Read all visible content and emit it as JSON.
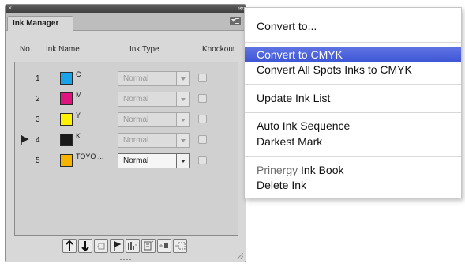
{
  "panel": {
    "tab_title": "Ink Manager",
    "close_glyph": "×",
    "collapse_glyph": "««",
    "headers": {
      "no": "No.",
      "ink_name": "Ink Name",
      "ink_type": "Ink Type",
      "knockout": "Knockout"
    }
  },
  "inks": [
    {
      "no": "1",
      "name": "C",
      "color": "#1aa3e8",
      "type": "Normal",
      "active": false,
      "marker": false
    },
    {
      "no": "2",
      "name": "M",
      "color": "#e0147f",
      "type": "Normal",
      "active": false,
      "marker": false
    },
    {
      "no": "3",
      "name": "Y",
      "color": "#fff200",
      "type": "Normal",
      "active": false,
      "marker": false
    },
    {
      "no": "4",
      "name": "K",
      "color": "#1a1a1a",
      "type": "Normal",
      "active": false,
      "marker": true
    },
    {
      "no": "5",
      "name": "TOYO ...",
      "color": "#f5b400",
      "type": "Normal",
      "active": true,
      "marker": false
    }
  ],
  "toolbar_icons": [
    "move-up-icon",
    "move-down-icon",
    "alias-ink-icon",
    "set-order-icon",
    "neutral-density-icon",
    "sort-icon",
    "add-ink-icon",
    "new-ink-icon"
  ],
  "menu": {
    "items": [
      {
        "label": "Convert to..."
      },
      {
        "label": "Convert to CMYK"
      },
      {
        "label": "Convert All Spots Inks to CMYK"
      },
      {
        "label": "Update Ink List"
      },
      {
        "label": "Auto Ink Sequence"
      },
      {
        "label": "Darkest Mark"
      },
      {
        "label_pre": "Prinergy",
        "label_post": " Ink Book"
      },
      {
        "label": "Delete Ink"
      }
    ]
  },
  "colors": {
    "highlight": "#4a62dc"
  }
}
